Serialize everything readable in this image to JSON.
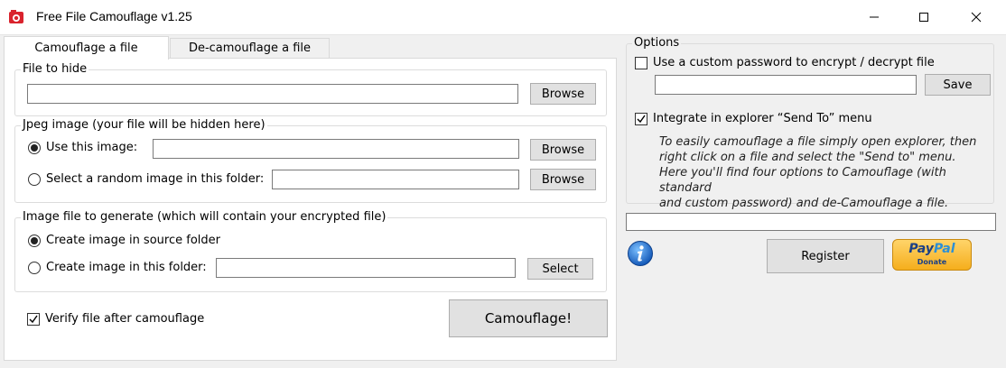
{
  "window": {
    "title": "Free File Camouflage v1.25",
    "minimize": "minimize",
    "maximize": "maximize",
    "close": "close"
  },
  "tabs": [
    {
      "label": "Camouflage a file",
      "active": true
    },
    {
      "label": "De-camouflage a file",
      "active": false
    }
  ],
  "file_to_hide": {
    "group_title": "File to hide",
    "value": "",
    "browse_label": "Browse"
  },
  "jpeg_image": {
    "group_title": "Jpeg image (your file will be hidden here)",
    "option_use": {
      "label": "Use this image:",
      "selected": true,
      "value": "",
      "button": "Browse"
    },
    "option_random": {
      "label": "Select a random image in this folder:",
      "selected": false,
      "value": "",
      "button": "Browse"
    }
  },
  "generate": {
    "group_title": "Image file to generate (which will contain your encrypted file)",
    "option_source": {
      "label": "Create image in source folder",
      "selected": true
    },
    "option_folder": {
      "label": "Create image in this folder:",
      "selected": false,
      "value": "",
      "button": "Select"
    }
  },
  "verify": {
    "label": "Verify file after camouflage",
    "checked": true
  },
  "camouflage_button": "Camouflage!",
  "options": {
    "group_title": "Options",
    "custom_password": {
      "label": "Use a custom password to encrypt / decrypt file",
      "checked": false,
      "value": "",
      "save_label": "Save"
    },
    "integrate": {
      "label": "Integrate in explorer “Send To” menu",
      "checked": true
    },
    "note": [
      "To easily camouflage a file simply open explorer, then",
      "right click on a file and select the \"Send to\" menu.",
      "Here you'll find four options to Camouflage (with standard",
      "and custom password) and de-Camouflage a file."
    ]
  },
  "status_field": "",
  "register_label": "Register",
  "paypal": {
    "brand_pay": "Pay",
    "brand_pal": "Pal",
    "donate": "Donate"
  },
  "colors": {
    "accent_blue": "#1e6ec8",
    "paypal_gold": "#f5b323"
  }
}
